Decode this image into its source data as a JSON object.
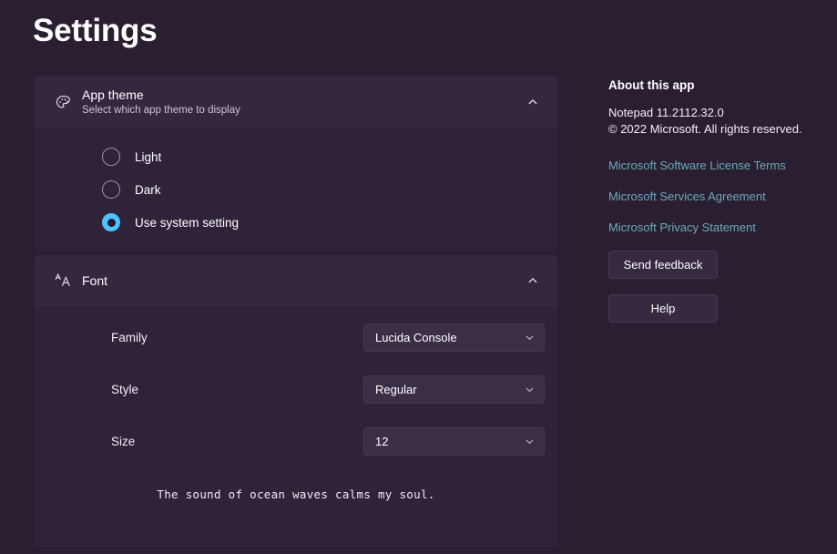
{
  "page": {
    "title": "Settings"
  },
  "app_theme": {
    "icon": "palette-icon",
    "title": "App theme",
    "subtitle": "Select which app theme to display",
    "expand_icon": "chevron-up-icon",
    "options": [
      {
        "label": "Light",
        "selected": false
      },
      {
        "label": "Dark",
        "selected": false
      },
      {
        "label": "Use system setting",
        "selected": true
      }
    ]
  },
  "font": {
    "icon": "font-size-icon",
    "title": "Font",
    "expand_icon": "chevron-up-icon",
    "rows": [
      {
        "label": "Family",
        "value": "Lucida Console",
        "icon": "chevron-down-icon"
      },
      {
        "label": "Style",
        "value": "Regular",
        "icon": "chevron-down-icon"
      },
      {
        "label": "Size",
        "value": "12",
        "icon": "chevron-down-icon"
      }
    ],
    "preview_text": "The sound of ocean waves calms my soul."
  },
  "about": {
    "heading": "About this app",
    "app_version": "Notepad 11.2112.32.0",
    "copyright": "© 2022 Microsoft. All rights reserved.",
    "links": [
      "Microsoft Software License Terms",
      "Microsoft Services Agreement",
      "Microsoft Privacy Statement"
    ],
    "buttons": {
      "feedback": "Send feedback",
      "help": "Help"
    }
  },
  "colors": {
    "page_background": "#2a1f30",
    "card_background": "#2e2338",
    "card_header_background": "#332840",
    "accent": "#4cc2ff",
    "link": "#6ca8bd",
    "control_background": "#3b2f47"
  }
}
